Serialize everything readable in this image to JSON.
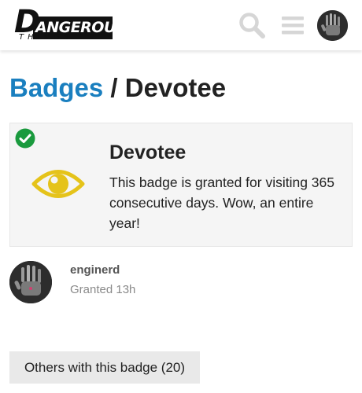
{
  "header": {
    "logo": {
      "initial": "D",
      "word": "ANGEROUS",
      "sub": "THINGS"
    },
    "search_icon": "search-icon",
    "menu_icon": "hamburger-menu-icon",
    "avatar_icon": "user-avatar"
  },
  "breadcrumb": {
    "parent": "Badges",
    "separator": "/",
    "current": "Devotee"
  },
  "badge": {
    "name": "Devotee",
    "description": "This badge is granted for visiting 365 consecutive days. Wow, an entire year!",
    "icon": "eye-icon",
    "icon_color": "#e5c31a",
    "granted_icon": "check-circle-icon",
    "granted_color": "#1a9a3e"
  },
  "grant": {
    "username": "enginerd",
    "granted_text": "Granted 13h"
  },
  "others_button": {
    "label": "Others with this badge (20)"
  },
  "colors": {
    "link": "#1a7fbf",
    "card_bg": "#f5f5f5",
    "button_bg": "#e9e9e9",
    "icon_gray": "#d6d6d6"
  }
}
